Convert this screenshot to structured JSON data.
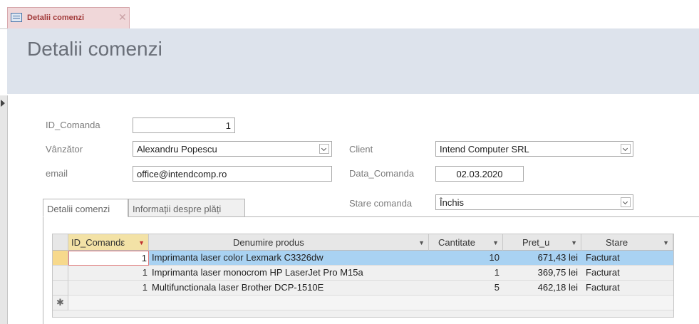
{
  "window": {
    "tab_label": "Detalii comenzi",
    "tab_icon": "form-icon"
  },
  "header": {
    "title": "Detalii comenzi"
  },
  "form": {
    "id_comanda": {
      "label": "ID_Comanda",
      "value": "1"
    },
    "vanzator": {
      "label": "Vânzător",
      "value": "Alexandru Popescu"
    },
    "email": {
      "label": "email",
      "value": "office@intendcomp.ro"
    },
    "client": {
      "label": "Client",
      "value": "Intend Computer SRL"
    },
    "data_comanda": {
      "label": "Data_Comanda",
      "value": "02.03.2020"
    },
    "stare_comanda": {
      "label": "Stare comanda",
      "value": "Închis"
    }
  },
  "subtabs": [
    "Detalii comenzi",
    "Informații despre plăți"
  ],
  "grid": {
    "columns": [
      "ID_Comandε",
      "Denumire produs",
      "Cantitate",
      "Pret_u",
      "Stare"
    ],
    "rows": [
      {
        "id": "1",
        "produs": "Imprimanta laser color Lexmark C3326dw",
        "cantitate": "10",
        "pret": "671,43 lei",
        "stare": "Facturat"
      },
      {
        "id": "1",
        "produs": "Imprimanta laser monocrom HP LaserJet Pro M15a",
        "cantitate": "1",
        "pret": "369,75 lei",
        "stare": "Facturat"
      },
      {
        "id": "1",
        "produs": "Multifunctionala laser Brother DCP-1510E",
        "cantitate": "5",
        "pret": "462,18 lei",
        "stare": "Facturat"
      }
    ],
    "new_row_marker": "✱"
  },
  "colors": {
    "tab_bg": "#f0d7d9",
    "header_bg": "#dde3ec",
    "selected_row": "#a9d2f2"
  }
}
